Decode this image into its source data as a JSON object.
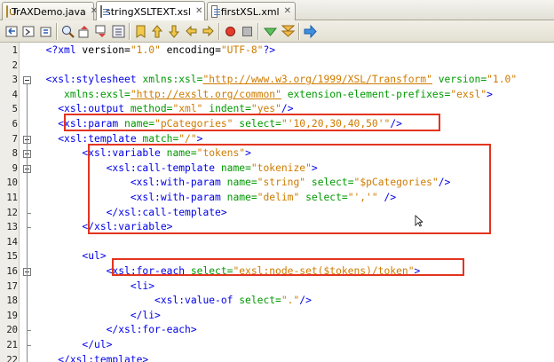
{
  "tabs": [
    {
      "label": "TrAXDemo.java",
      "icon": "java-file-icon",
      "active": false
    },
    {
      "label": "stringXSLTEXT.xsl",
      "icon": "xsl-file-icon",
      "active": true
    },
    {
      "label": "firstXSL.xml",
      "icon": "xml-file-icon",
      "active": false
    }
  ],
  "toolbar": {
    "buttons": [
      "back-icon",
      "forward-icon",
      "history-icon",
      "search-icon",
      "find-previous-icon",
      "find-next-icon",
      "toggle-highlight-icon",
      "toggle-bookmark-icon",
      "previous-bookmark-icon",
      "next-bookmark-icon",
      "shift-left-icon",
      "shift-right-icon",
      "start-macro-icon",
      "stop-macro-icon",
      "check-xml-icon",
      "validate-xml-icon",
      "run-xsl-icon"
    ]
  },
  "colors": {
    "tag": "#0000e6",
    "attribute": "#009900",
    "value": "#ce7b00",
    "highlight": "#e3341f"
  },
  "lines": [
    {
      "n": "1",
      "indent": "  ",
      "segs": [
        [
          "tag",
          "<?"
        ],
        [
          "tag",
          "xml"
        ],
        [
          "txt",
          " version="
        ],
        [
          "val",
          "\"1.0\""
        ],
        [
          "txt",
          " encoding="
        ],
        [
          "val",
          "\"UTF-8\""
        ],
        [
          "tag",
          "?>"
        ]
      ]
    },
    {
      "n": "2",
      "indent": "",
      "segs": []
    },
    {
      "n": "3",
      "indent": "  ",
      "segs": [
        [
          "tag",
          "<xsl:stylesheet "
        ],
        [
          "attr",
          "xmlns:xsl="
        ],
        [
          "url",
          "\"http://www.w3.org/1999/XSL/Transform\""
        ],
        [
          "attr",
          " version="
        ],
        [
          "val",
          "\"1.0\""
        ]
      ]
    },
    {
      "n": "4",
      "indent": "     ",
      "segs": [
        [
          "attr",
          "xmlns:exsl="
        ],
        [
          "url",
          "\"http://exslt.org/common\""
        ],
        [
          "attr",
          " extension-element-prefixes="
        ],
        [
          "val",
          "\"exsl\""
        ],
        [
          "tag",
          ">"
        ]
      ]
    },
    {
      "n": "5",
      "indent": "    ",
      "segs": [
        [
          "tag",
          "<xsl:output "
        ],
        [
          "attr",
          "method="
        ],
        [
          "val",
          "\"xml\""
        ],
        [
          "attr",
          " indent="
        ],
        [
          "val",
          "\"yes\""
        ],
        [
          "tag",
          "/>"
        ]
      ]
    },
    {
      "n": "6",
      "indent": "    ",
      "segs": [
        [
          "tag",
          "<xsl:param "
        ],
        [
          "attr",
          "name="
        ],
        [
          "val",
          "\"pCategories\""
        ],
        [
          "attr",
          " select="
        ],
        [
          "val",
          "\"'10,20,30,40,50'\""
        ],
        [
          "tag",
          "/>"
        ]
      ]
    },
    {
      "n": "7",
      "indent": "    ",
      "segs": [
        [
          "tag",
          "<xsl:template "
        ],
        [
          "attr",
          "match="
        ],
        [
          "val",
          "\"/\""
        ],
        [
          "tag",
          ">"
        ]
      ]
    },
    {
      "n": "8",
      "indent": "        ",
      "segs": [
        [
          "tag",
          "<xsl:variable "
        ],
        [
          "attr",
          "name="
        ],
        [
          "val",
          "\"tokens\""
        ],
        [
          "tag",
          ">"
        ]
      ]
    },
    {
      "n": "9",
      "indent": "            ",
      "segs": [
        [
          "tag",
          "<xsl:call-template "
        ],
        [
          "attr",
          "name="
        ],
        [
          "val",
          "\"tokenize\""
        ],
        [
          "tag",
          ">"
        ]
      ]
    },
    {
      "n": "10",
      "indent": "                ",
      "segs": [
        [
          "tag",
          "<xsl:with-param "
        ],
        [
          "attr",
          "name="
        ],
        [
          "val",
          "\"string\""
        ],
        [
          "attr",
          " select="
        ],
        [
          "val",
          "\"$pCategories\""
        ],
        [
          "tag",
          "/>"
        ]
      ]
    },
    {
      "n": "11",
      "indent": "                ",
      "segs": [
        [
          "tag",
          "<xsl:with-param "
        ],
        [
          "attr",
          "name="
        ],
        [
          "val",
          "\"delim\""
        ],
        [
          "attr",
          " select="
        ],
        [
          "val",
          "\"','\""
        ],
        [
          "tag",
          " />"
        ]
      ]
    },
    {
      "n": "12",
      "indent": "            ",
      "segs": [
        [
          "tag",
          "</xsl:call-template>"
        ]
      ]
    },
    {
      "n": "13",
      "indent": "        ",
      "segs": [
        [
          "tag",
          "</xsl:variable>"
        ]
      ]
    },
    {
      "n": "14",
      "indent": "",
      "segs": []
    },
    {
      "n": "15",
      "indent": "        ",
      "segs": [
        [
          "tag",
          "<ul>"
        ]
      ]
    },
    {
      "n": "16",
      "indent": "            ",
      "segs": [
        [
          "tag",
          "<xsl:for-each "
        ],
        [
          "attr",
          "select="
        ],
        [
          "val",
          "\"exsl:node-set($tokens)/token\""
        ],
        [
          "tag",
          ">"
        ]
      ]
    },
    {
      "n": "17",
      "indent": "                ",
      "segs": [
        [
          "tag",
          "<li>"
        ]
      ]
    },
    {
      "n": "18",
      "indent": "                    ",
      "segs": [
        [
          "tag",
          "<xsl:value-of "
        ],
        [
          "attr",
          "select="
        ],
        [
          "val",
          "\".\""
        ],
        [
          "tag",
          "/>"
        ]
      ]
    },
    {
      "n": "19",
      "indent": "                ",
      "segs": [
        [
          "tag",
          "</li>"
        ]
      ]
    },
    {
      "n": "20",
      "indent": "            ",
      "segs": [
        [
          "tag",
          "</xsl:for-each>"
        ]
      ]
    },
    {
      "n": "21",
      "indent": "        ",
      "segs": [
        [
          "tag",
          "</ul>"
        ]
      ]
    },
    {
      "n": "22",
      "indent": "    ",
      "segs": [
        [
          "tag",
          "</xsl:template>"
        ]
      ]
    }
  ]
}
